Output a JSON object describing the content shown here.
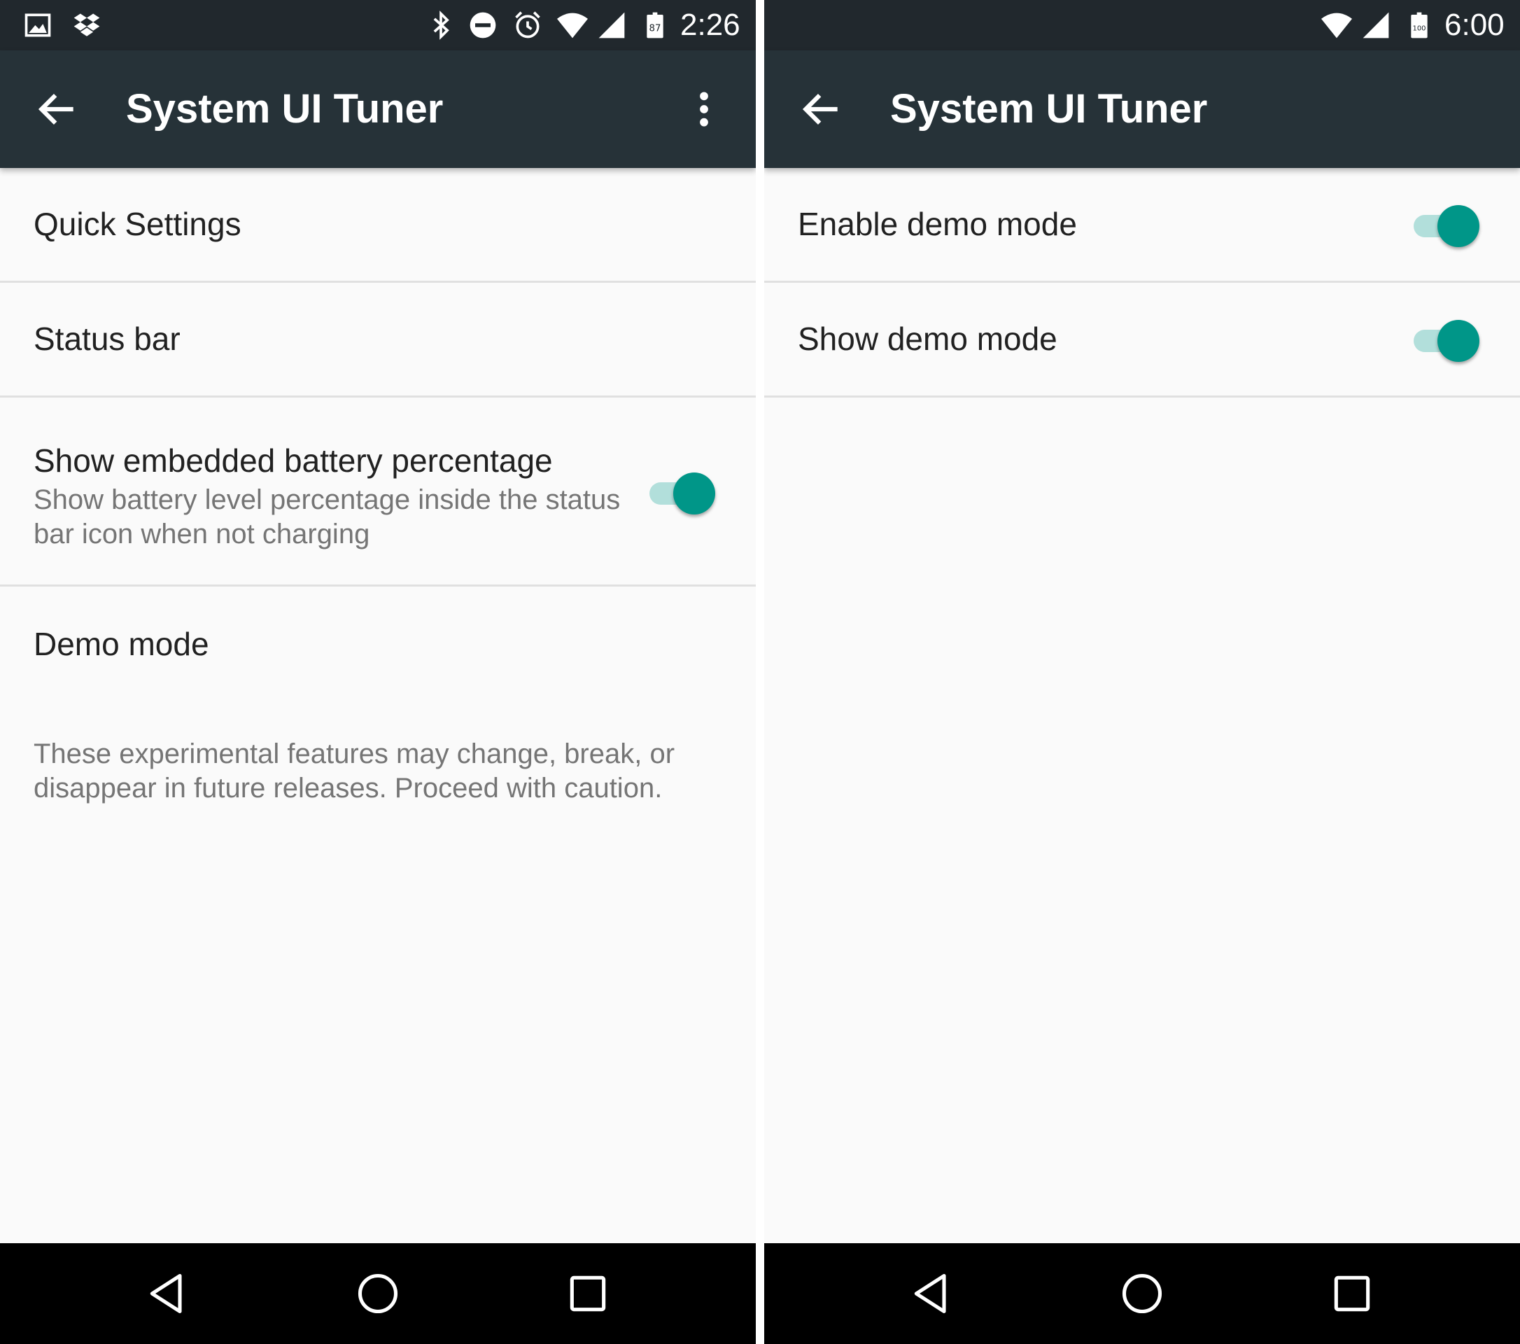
{
  "colors": {
    "status_bar": "#21282d",
    "toolbar": "#263238",
    "background": "#fafafa",
    "accent": "#009688",
    "accent_track": "#b2dfdb",
    "divider": "#e0e0e0",
    "nav_bar": "#000000"
  },
  "left": {
    "status_bar": {
      "time": "2:26",
      "battery_level": "87",
      "icons": [
        "image-icon",
        "dropbox-icon",
        "bluetooth-icon",
        "do-not-disturb-icon",
        "alarm-icon",
        "wifi-icon",
        "cell-signal-icon",
        "battery-icon"
      ]
    },
    "toolbar": {
      "title": "System UI Tuner",
      "back_icon": "arrow-back-icon",
      "menu_icon": "more-vert-icon"
    },
    "items": [
      {
        "title": "Quick Settings"
      },
      {
        "title": "Status bar"
      },
      {
        "title": "Show embedded battery percentage",
        "summary": "Show battery level percentage inside the status bar icon when not charging",
        "toggle": true
      },
      {
        "title": "Demo mode"
      }
    ],
    "footer": "These experimental features may change, break, or disappear in future releases. Proceed with caution.",
    "nav_bar": [
      "back-icon",
      "home-icon",
      "recents-icon"
    ]
  },
  "right": {
    "status_bar": {
      "time": "6:00",
      "battery_level": "100",
      "icons": [
        "wifi-icon",
        "cell-signal-icon",
        "battery-icon"
      ]
    },
    "toolbar": {
      "title": "System UI Tuner",
      "back_icon": "arrow-back-icon"
    },
    "items": [
      {
        "title": "Enable demo mode",
        "toggle": true
      },
      {
        "title": "Show demo mode",
        "toggle": true
      }
    ],
    "nav_bar": [
      "back-icon",
      "home-icon",
      "recents-icon"
    ]
  }
}
